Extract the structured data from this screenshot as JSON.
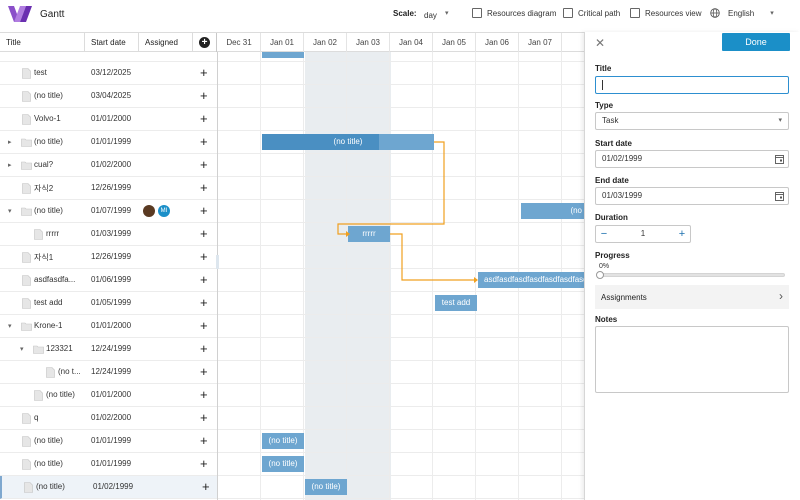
{
  "app": {
    "title": "Gantt"
  },
  "toolbar": {
    "scale_label": "Scale:",
    "scale_value": "day",
    "resources_diagram": "Resources diagram",
    "critical_path": "Critical path",
    "resources_view": "Resources view",
    "language": "English"
  },
  "grid": {
    "columns": {
      "title": "Title",
      "start_date": "Start date",
      "assigned": "Assigned"
    },
    "days": [
      "Dec 31",
      "Jan 01",
      "Jan 02",
      "Jan 03",
      "Jan 04",
      "Jan 05",
      "Jan 06",
      "Jan 07",
      ""
    ],
    "rows": [
      {
        "title": "test",
        "date": "03/12/2025"
      },
      {
        "title": "(no title)",
        "date": "03/04/2025"
      },
      {
        "title": "Volvo-1",
        "date": "01/01/2000"
      },
      {
        "title": "(no title)",
        "date": "01/01/1999"
      },
      {
        "title": "cual?",
        "date": "01/02/2000"
      },
      {
        "title": "자식2",
        "date": "12/26/1999"
      },
      {
        "title": "(no title)",
        "date": "01/07/1999"
      },
      {
        "title": "rrrrr",
        "date": "01/03/1999"
      },
      {
        "title": "자식1",
        "date": "12/26/1999"
      },
      {
        "title": "asdfasdfa...",
        "date": "01/06/1999"
      },
      {
        "title": "test add",
        "date": "01/05/1999"
      },
      {
        "title": "Krone-1",
        "date": "01/01/2000"
      },
      {
        "title": "123321",
        "date": "12/24/1999"
      },
      {
        "title": "(no t...",
        "date": "12/24/1999"
      },
      {
        "title": "(no title)",
        "date": "01/01/2000"
      },
      {
        "title": "q",
        "date": "01/02/2000"
      },
      {
        "title": "(no title)",
        "date": "01/01/1999"
      },
      {
        "title": "(no title)",
        "date": "01/01/1999"
      },
      {
        "title": "(no title)",
        "date": "01/02/1999"
      }
    ],
    "avatar_initials": "MI"
  },
  "bars": {
    "no_title": "(no title)",
    "rrrrr": "rrrrr",
    "asdf": "asdfasdfasdfasdfasdfasdfasdf",
    "test_add": "test add",
    "no_title_short": "(no"
  },
  "panel": {
    "done": "Done",
    "title_label": "Title",
    "title_value": "",
    "type_label": "Type",
    "type_value": "Task",
    "start_label": "Start date",
    "start_value": "01/02/1999",
    "end_label": "End date",
    "end_value": "01/03/1999",
    "duration_label": "Duration",
    "duration_value": "1",
    "progress_label": "Progress",
    "progress_value": "0%",
    "progress_fraction": 0,
    "assignments_label": "Assignments",
    "notes_label": "Notes"
  },
  "colors": {
    "accent": "#1b8fc8",
    "bar": "#6ea6d0",
    "bar_dark": "#4a8fc2",
    "link": "#f0a020"
  }
}
